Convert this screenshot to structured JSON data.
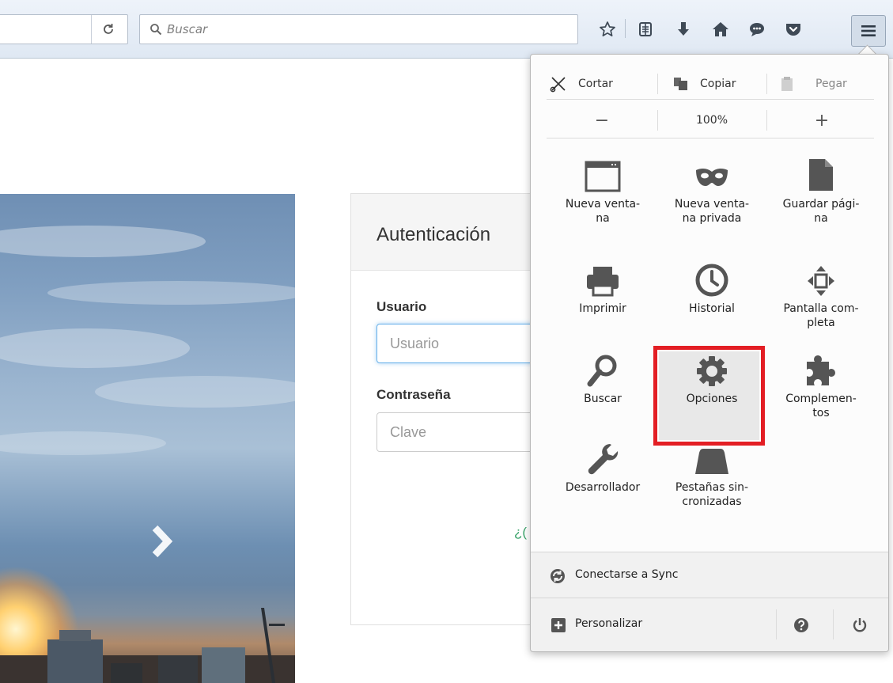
{
  "toolbar": {
    "search_placeholder": "Buscar",
    "icons": [
      "reload-icon",
      "bookmark-star-icon",
      "reading-list-icon",
      "download-icon",
      "home-icon",
      "chat-icon",
      "pocket-icon",
      "hamburger-menu-icon"
    ]
  },
  "login": {
    "title": "Autenticación",
    "user_label": "Usuario",
    "user_placeholder": "Usuario",
    "pass_label": "Contraseña",
    "pass_placeholder": "Clave",
    "link_fragment": "¿("
  },
  "menu": {
    "cut": "Cortar",
    "copy": "Copiar",
    "paste": "Pegar",
    "zoom_out": "−",
    "zoom_level": "100%",
    "zoom_in": "+",
    "items": [
      {
        "label": "Nueva venta-\nna",
        "icon": "new-window-icon"
      },
      {
        "label": "Nueva venta-\nna privada",
        "icon": "private-mask-icon"
      },
      {
        "label": "Guardar pági-\nna",
        "icon": "save-page-icon"
      },
      {
        "label": "Imprimir",
        "icon": "printer-icon"
      },
      {
        "label": "Historial",
        "icon": "history-clock-icon"
      },
      {
        "label": "Pantalla com-\npleta",
        "icon": "fullscreen-icon"
      },
      {
        "label": "Buscar",
        "icon": "search-icon"
      },
      {
        "label": "Opciones",
        "icon": "gear-icon"
      },
      {
        "label": "Complemen-\ntos",
        "icon": "puzzle-icon"
      },
      {
        "label": "Desarrollador",
        "icon": "wrench-icon"
      },
      {
        "label": "Pestañas sin-\ncronizadas",
        "icon": "synced-tabs-icon"
      }
    ],
    "sync": "Conectarse a Sync",
    "customize": "Personalizar",
    "highlight_color": "#e31e24"
  }
}
